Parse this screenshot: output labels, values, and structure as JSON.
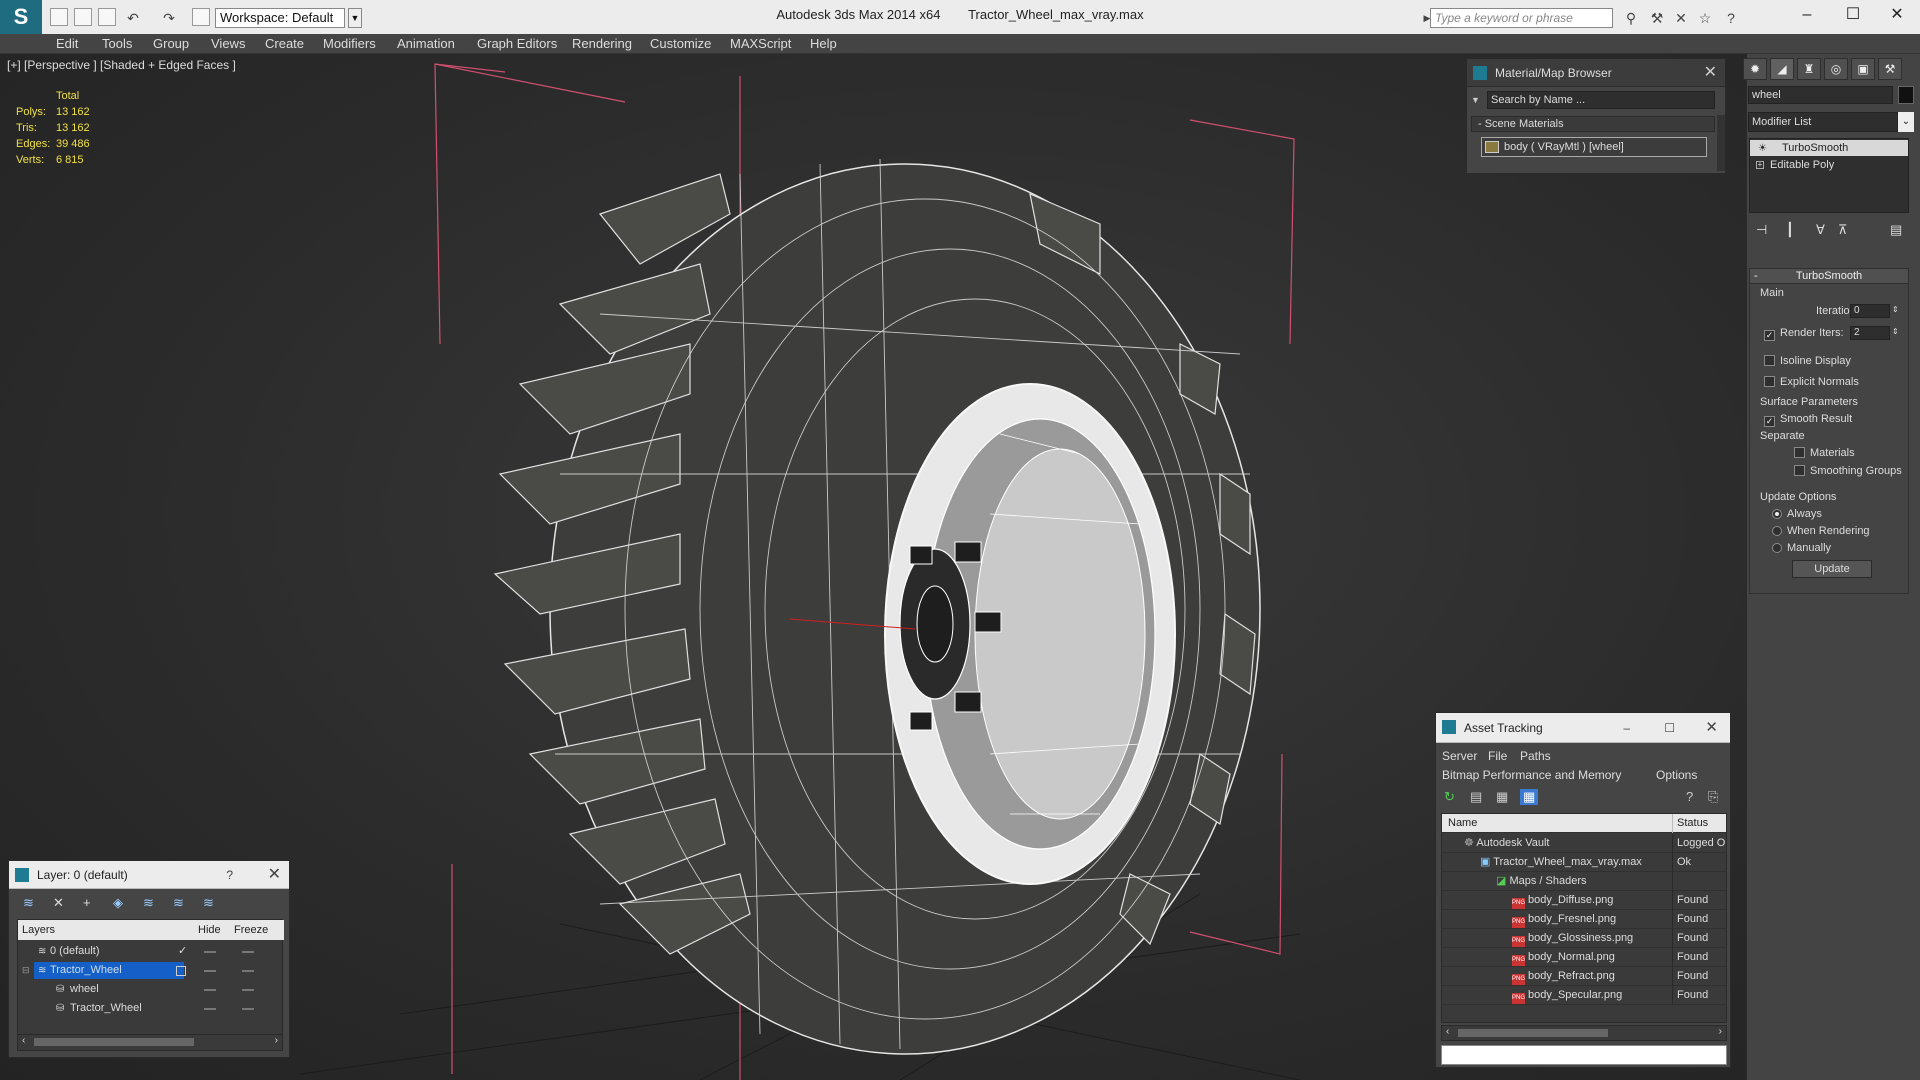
{
  "window": {
    "app_title": "Autodesk 3ds Max  2014 x64",
    "file_title": "Tractor_Wheel_max_vray.max",
    "workspace": "Workspace: Default",
    "search_placeholder": "Type a keyword or phrase"
  },
  "menu": [
    "Edit",
    "Tools",
    "Group",
    "Views",
    "Create",
    "Modifiers",
    "Animation",
    "Graph Editors",
    "Rendering",
    "Customize",
    "MAXScript",
    "Help"
  ],
  "viewport": {
    "label": "[+] [Perspective ] [Shaded + Edged Faces ]",
    "stats_header": "Total",
    "stats": [
      {
        "label": "Polys:",
        "value": "13 162"
      },
      {
        "label": "Tris:",
        "value": "13 162"
      },
      {
        "label": "Edges:",
        "value": "39 486"
      },
      {
        "label": "Verts:",
        "value": "6 815"
      }
    ],
    "stats_color": "#f0e040"
  },
  "material_browser": {
    "title": "Material/Map Browser",
    "search_placeholder": "Search by Name ...",
    "section": "- Scene Materials",
    "material": "body  ( VRayMtl ) [wheel]"
  },
  "command_panel": {
    "object_name": "wheel",
    "modifier_list": "Modifier List",
    "stack": [
      "TurboSmooth",
      "Editable Poly"
    ],
    "rollout_title": "TurboSmooth",
    "main_label": "Main",
    "iterations_label": "Iterations:",
    "iterations_value": "0",
    "render_iters_label": "Render Iters:",
    "render_iters_value": "2",
    "isoline_label": "Isoline Display",
    "explicit_normals_label": "Explicit Normals",
    "surface_params_label": "Surface Parameters",
    "smooth_result_label": "Smooth Result",
    "separate_label": "Separate",
    "materials_label": "Materials",
    "smoothing_groups_label": "Smoothing Groups",
    "update_options_label": "Update Options",
    "always_label": "Always",
    "when_rendering_label": "When Rendering",
    "manually_label": "Manually",
    "update_button": "Update"
  },
  "asset_tracking": {
    "title": "Asset Tracking",
    "menu": [
      "Server",
      "File",
      "Paths"
    ],
    "menu2": [
      "Bitmap Performance and Memory",
      "Options"
    ],
    "col_name": "Name",
    "col_status": "Status",
    "rows": [
      {
        "name": "Autodesk Vault",
        "status": "Logged O"
      },
      {
        "name": "Tractor_Wheel_max_vray.max",
        "status": "Ok"
      },
      {
        "name": "Maps / Shaders",
        "status": ""
      },
      {
        "name": "body_Diffuse.png",
        "status": "Found"
      },
      {
        "name": "body_Fresnel.png",
        "status": "Found"
      },
      {
        "name": "body_Glossiness.png",
        "status": "Found"
      },
      {
        "name": "body_Normal.png",
        "status": "Found"
      },
      {
        "name": "body_Refract.png",
        "status": "Found"
      },
      {
        "name": "body_Specular.png",
        "status": "Found"
      }
    ],
    "png_badge": "PNG"
  },
  "layers": {
    "title": "Layer: 0 (default)",
    "help": "?",
    "col_layers": "Layers",
    "col_hide": "Hide",
    "col_freeze": "Freeze",
    "rows": [
      {
        "name": "0 (default)"
      },
      {
        "name": "Tractor_Wheel"
      },
      {
        "name": "wheel"
      },
      {
        "name": "Tractor_Wheel"
      }
    ],
    "selected_color": "#1560c8"
  }
}
